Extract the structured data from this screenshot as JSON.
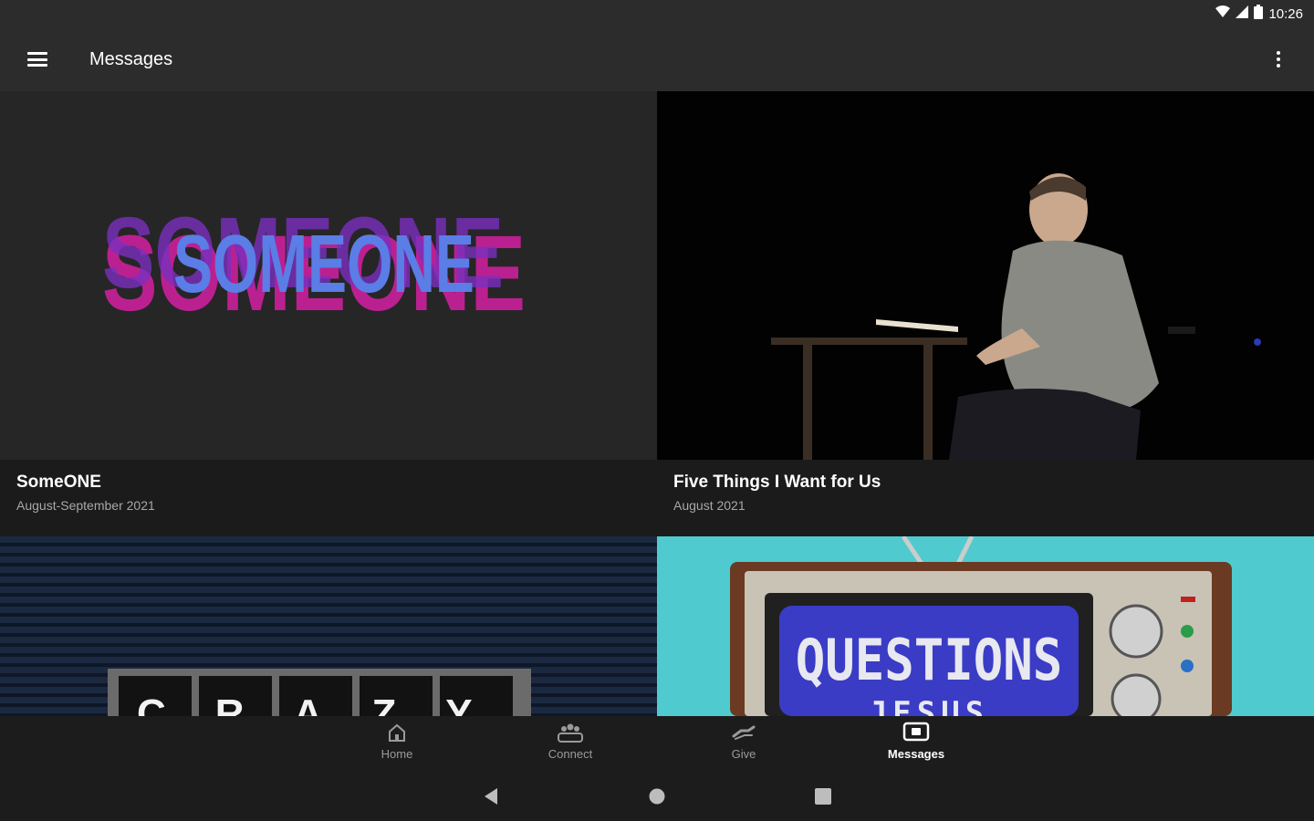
{
  "status_bar": {
    "time": "10:26",
    "icons": [
      "wifi-icon",
      "signal-icon",
      "battery-icon"
    ]
  },
  "app_bar": {
    "title": "Messages",
    "menu_icon": "hamburger-menu-icon",
    "overflow_icon": "more-vert-icon"
  },
  "cards": [
    {
      "title": "SomeONE",
      "subtitle": "August-September 2021",
      "artwork_text": "SOMEONE"
    },
    {
      "title": "Five Things I Want for Us",
      "subtitle": "August 2021"
    },
    {
      "title": "",
      "subtitle": "",
      "artwork_text": "CRAZY"
    },
    {
      "title": "",
      "subtitle": "",
      "artwork_text": "QUESTIONS",
      "artwork_text_2": "JESUS"
    }
  ],
  "bottom_nav": [
    {
      "label": "Home",
      "icon": "home-icon"
    },
    {
      "label": "Connect",
      "icon": "people-icon"
    },
    {
      "label": "Give",
      "icon": "give-hand-icon"
    },
    {
      "label": "Messages",
      "icon": "video-play-icon",
      "active": true
    }
  ],
  "system_nav": {
    "back": "back-icon",
    "home": "home-circle-icon",
    "recents": "recents-icon"
  },
  "colors": {
    "app_bar": "#2c2c2c",
    "background": "#202020",
    "meta_bg": "#1b1b1b",
    "accent_magenta": "#d61fa4",
    "accent_blue": "#5b7de6",
    "tv_teal": "#4fcbd0"
  }
}
